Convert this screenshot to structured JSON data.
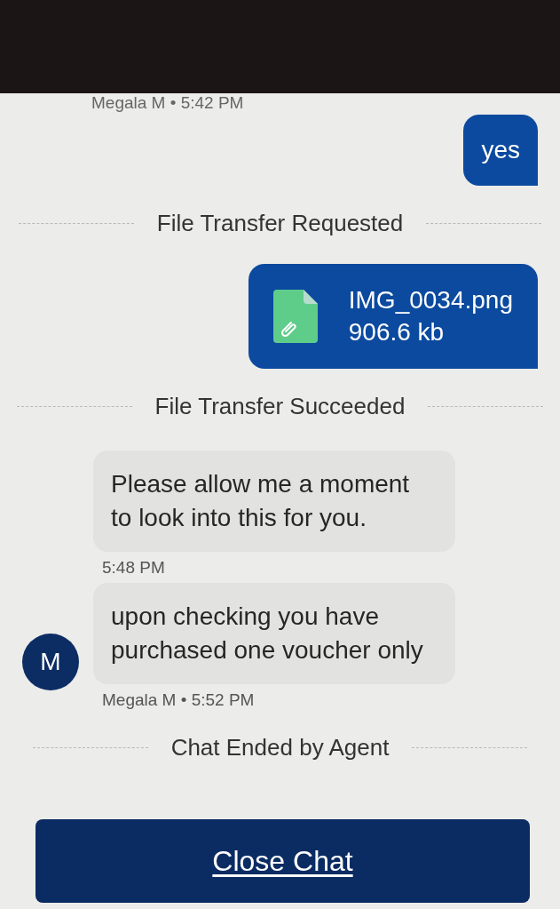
{
  "messages": [
    {
      "kind": "meta",
      "text": "Megala M • 5:42 PM"
    },
    {
      "kind": "sent_text",
      "text": "yes"
    },
    {
      "kind": "event",
      "text": "File Transfer Requested"
    },
    {
      "kind": "sent_file",
      "file_name": "IMG_0034.png",
      "file_size": "906.6 kb"
    },
    {
      "kind": "event",
      "text": "File Transfer Succeeded"
    },
    {
      "kind": "received",
      "text": "Please allow me a moment to look into this for you.",
      "meta": "5:48 PM"
    },
    {
      "kind": "received",
      "text": "upon checking you have purchased one voucher only",
      "avatar": "M",
      "meta": "Megala M • 5:52 PM"
    },
    {
      "kind": "event",
      "text": "Chat Ended by Agent"
    }
  ],
  "close_button": {
    "label": "Close Chat"
  }
}
